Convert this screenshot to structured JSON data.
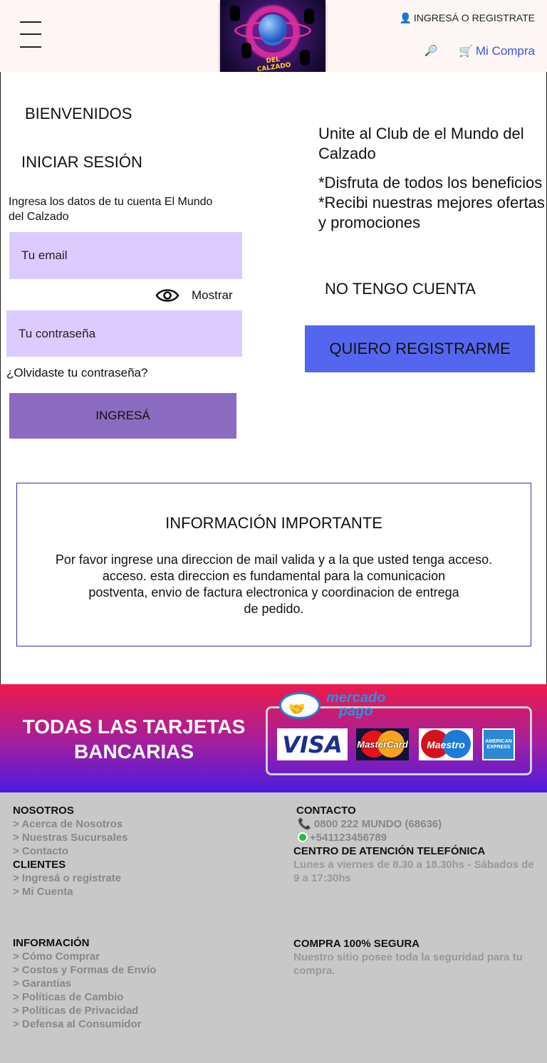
{
  "header": {
    "logo_text": "DEL CALZADO",
    "login_icon": "user-icon",
    "login_label": "INGRESÁ O REGISTRATE",
    "search_icon": "magnifier-icon",
    "cart_icon": "cart-icon",
    "cart_label": "Mi Compra"
  },
  "login": {
    "welcome": "BIENVENIDOS",
    "title": "INICIAR SESIÓN",
    "instructions": "Ingresa los datos de  tu cuenta El Mundo del Calzado",
    "email_placeholder": "Tu email",
    "password_placeholder": "Tu contraseña",
    "show_label": "Mostrar",
    "forgot_label": "¿Olvidaste tu contraseña?",
    "submit_label": "INGRESÁ"
  },
  "register": {
    "club_title": "Unite al Club  de el Mundo del Calzado",
    "benefits": [
      "*Disfruta de todos los beneficios",
      "*Recibi nuestras mejores ofertas y promociones"
    ],
    "no_account": "NO TENGO CUENTA",
    "register_label": "QUIERO REGISTRARME"
  },
  "info": {
    "title": "INFORMACIÓN IMPORTANTE",
    "lines": [
      "Por favor ingrese una direccion de mail valida y a la que usted tenga acceso.",
      "acceso. esta direccion es fundamental para la comunicacion",
      "postventa, envio de factura electronica y coordinacion de entrega",
      "de pedido."
    ]
  },
  "banner": {
    "title": "TODAS LAS TARJETAS BANCARIAS",
    "provider_line1": "mercado",
    "provider_line2": "pago",
    "cards": [
      "VISA",
      "MasterCard",
      "Maestro",
      "AMERICAN EXPRESS"
    ]
  },
  "footer": {
    "nosotros": {
      "heading": "NOSOTROS",
      "links": [
        "> Acerca de Nosotros",
        "> Nuestras Sucursales",
        "> Contacto"
      ]
    },
    "clientes": {
      "heading": "CLIENTES",
      "links": [
        "> Ingresá o registrate",
        "> Mi Cuenta"
      ]
    },
    "informacion": {
      "heading": "INFORMACIÓN",
      "links": [
        "> Cómo Comprar",
        "> Costos y Formas de Envío",
        "> Garantías",
        "> Políticas de Cambio",
        "> Políticas de Privacidad",
        "> Defensa al Consumidor"
      ]
    },
    "contacto": {
      "heading": "CONTACTO",
      "phone": "0800 222 MUNDO (68636)",
      "whatsapp": "+541123456789",
      "call_center_heading": "CENTRO DE ATENCIÓN TELEFÓNICA",
      "hours": "Lunes a viernes de 8.30 a 18.30hs - Sábados de 9 a 17:30hs"
    },
    "seguridad": {
      "heading": "COMPRA 100% SEGURA",
      "text": "Nuestro sitio posee toda la seguridad para tu compra."
    }
  }
}
